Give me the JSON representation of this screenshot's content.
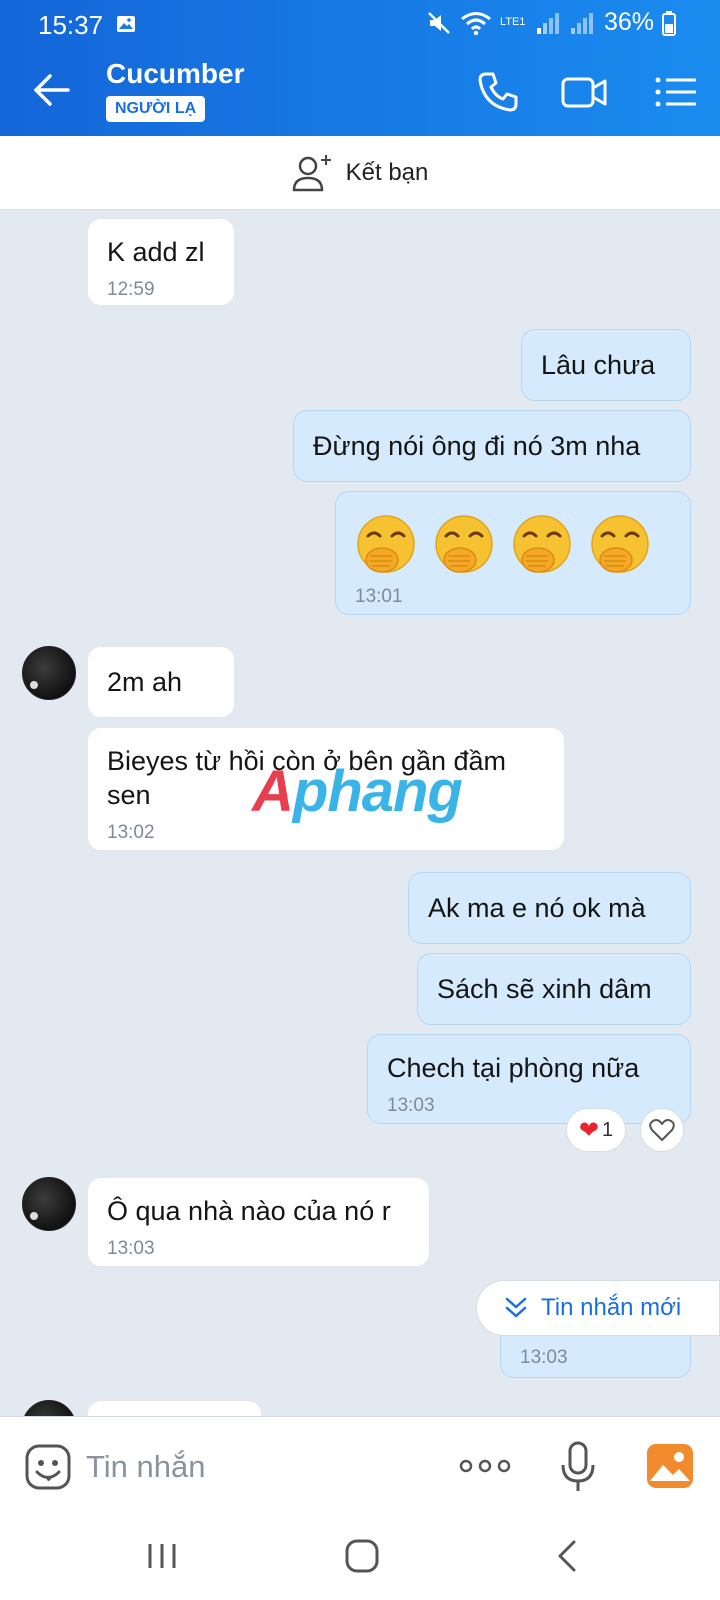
{
  "status_bar": {
    "time": "15:37",
    "battery": "36%",
    "network_label": "LTE1"
  },
  "header": {
    "contact_name": "Cucumber",
    "badge": "NGƯỜI LẠ"
  },
  "add_friend": {
    "label": "Kết bạn"
  },
  "messages": {
    "m1": {
      "text": "K add zl",
      "time": "12:59"
    },
    "m2": {
      "text": "Lâu chưa"
    },
    "m3": {
      "text": "Đừng nói ông đi nó 3m nha"
    },
    "m4": {
      "emoji": "face-with-hand-over-mouth",
      "count": 4,
      "time": "13:01"
    },
    "m5": {
      "text": "2m ah"
    },
    "m6": {
      "text_line1": "Bieyes từ hồi còn ở bên gần đầm",
      "text_line2": "sen",
      "time": "13:02"
    },
    "m7": {
      "text": "Ak ma e nó ok mà"
    },
    "m8": {
      "text": "Sách sẽ xinh dâm"
    },
    "m9": {
      "text": "Chech tại phòng nữa",
      "time": "13:03",
      "reaction_count": "1"
    },
    "m10": {
      "text": "Ô qua nhà nào của nó r",
      "time": "13:03"
    },
    "m11": {
      "time": "13:03"
    }
  },
  "watermark": {
    "part1": "A",
    "part2": "phang"
  },
  "new_messages": {
    "label": "Tin nhắn mới"
  },
  "input": {
    "placeholder": "Tin nhắn"
  },
  "colors": {
    "header_blue": "#1a8cf0",
    "incoming_bubble": "#ffffff",
    "outgoing_bubble": "#d5ebfd",
    "chat_background": "#e2e9f1"
  }
}
